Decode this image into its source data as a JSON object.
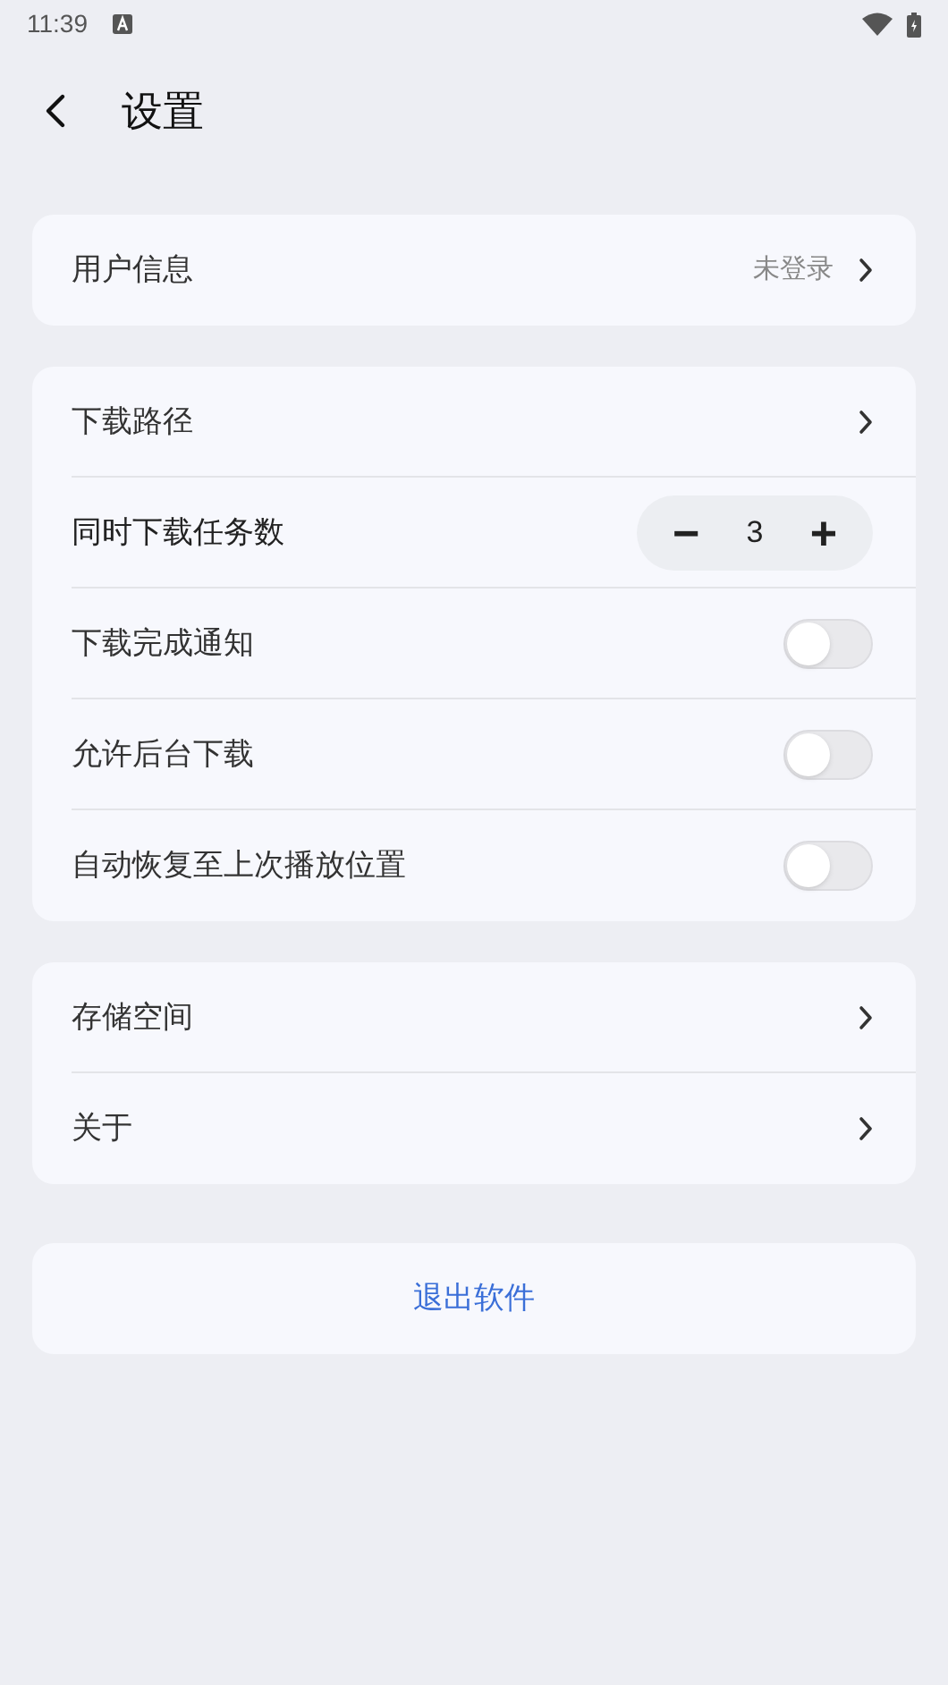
{
  "status_bar": {
    "time": "11:39"
  },
  "header": {
    "title": "设置"
  },
  "groups": [
    {
      "items": [
        {
          "kind": "link",
          "label": "用户信息",
          "value": "未登录"
        }
      ]
    },
    {
      "items": [
        {
          "kind": "link",
          "label": "下载路径"
        },
        {
          "kind": "stepper",
          "label": "同时下载任务数",
          "value": "3",
          "minus": "−",
          "plus": "+"
        },
        {
          "kind": "toggle",
          "label": "下载完成通知",
          "on": false
        },
        {
          "kind": "toggle",
          "label": "允许后台下载",
          "on": false
        },
        {
          "kind": "toggle",
          "label": "自动恢复至上次播放位置",
          "on": false
        }
      ]
    },
    {
      "items": [
        {
          "kind": "link",
          "label": "存储空间"
        },
        {
          "kind": "link",
          "label": "关于"
        }
      ]
    }
  ],
  "exit_button": "退出软件"
}
